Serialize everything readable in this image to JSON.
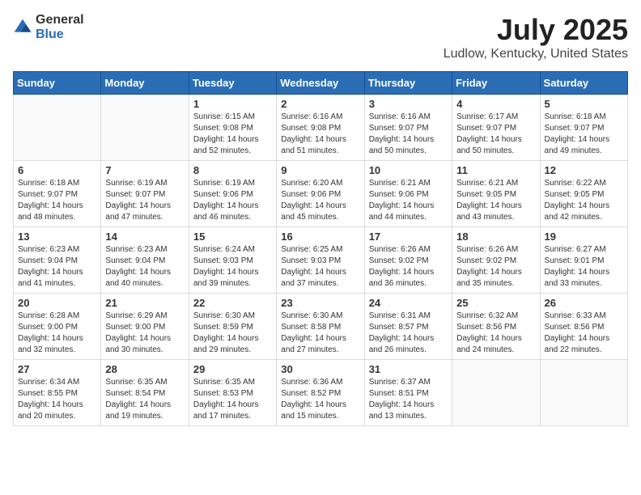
{
  "logo": {
    "text_general": "General",
    "text_blue": "Blue"
  },
  "header": {
    "month": "July 2025",
    "location": "Ludlow, Kentucky, United States"
  },
  "days_of_week": [
    "Sunday",
    "Monday",
    "Tuesday",
    "Wednesday",
    "Thursday",
    "Friday",
    "Saturday"
  ],
  "weeks": [
    [
      {
        "day": "",
        "info": ""
      },
      {
        "day": "",
        "info": ""
      },
      {
        "day": "1",
        "info": "Sunrise: 6:15 AM\nSunset: 9:08 PM\nDaylight: 14 hours and 52 minutes."
      },
      {
        "day": "2",
        "info": "Sunrise: 6:16 AM\nSunset: 9:08 PM\nDaylight: 14 hours and 51 minutes."
      },
      {
        "day": "3",
        "info": "Sunrise: 6:16 AM\nSunset: 9:07 PM\nDaylight: 14 hours and 50 minutes."
      },
      {
        "day": "4",
        "info": "Sunrise: 6:17 AM\nSunset: 9:07 PM\nDaylight: 14 hours and 50 minutes."
      },
      {
        "day": "5",
        "info": "Sunrise: 6:18 AM\nSunset: 9:07 PM\nDaylight: 14 hours and 49 minutes."
      }
    ],
    [
      {
        "day": "6",
        "info": "Sunrise: 6:18 AM\nSunset: 9:07 PM\nDaylight: 14 hours and 48 minutes."
      },
      {
        "day": "7",
        "info": "Sunrise: 6:19 AM\nSunset: 9:07 PM\nDaylight: 14 hours and 47 minutes."
      },
      {
        "day": "8",
        "info": "Sunrise: 6:19 AM\nSunset: 9:06 PM\nDaylight: 14 hours and 46 minutes."
      },
      {
        "day": "9",
        "info": "Sunrise: 6:20 AM\nSunset: 9:06 PM\nDaylight: 14 hours and 45 minutes."
      },
      {
        "day": "10",
        "info": "Sunrise: 6:21 AM\nSunset: 9:06 PM\nDaylight: 14 hours and 44 minutes."
      },
      {
        "day": "11",
        "info": "Sunrise: 6:21 AM\nSunset: 9:05 PM\nDaylight: 14 hours and 43 minutes."
      },
      {
        "day": "12",
        "info": "Sunrise: 6:22 AM\nSunset: 9:05 PM\nDaylight: 14 hours and 42 minutes."
      }
    ],
    [
      {
        "day": "13",
        "info": "Sunrise: 6:23 AM\nSunset: 9:04 PM\nDaylight: 14 hours and 41 minutes."
      },
      {
        "day": "14",
        "info": "Sunrise: 6:23 AM\nSunset: 9:04 PM\nDaylight: 14 hours and 40 minutes."
      },
      {
        "day": "15",
        "info": "Sunrise: 6:24 AM\nSunset: 9:03 PM\nDaylight: 14 hours and 39 minutes."
      },
      {
        "day": "16",
        "info": "Sunrise: 6:25 AM\nSunset: 9:03 PM\nDaylight: 14 hours and 37 minutes."
      },
      {
        "day": "17",
        "info": "Sunrise: 6:26 AM\nSunset: 9:02 PM\nDaylight: 14 hours and 36 minutes."
      },
      {
        "day": "18",
        "info": "Sunrise: 6:26 AM\nSunset: 9:02 PM\nDaylight: 14 hours and 35 minutes."
      },
      {
        "day": "19",
        "info": "Sunrise: 6:27 AM\nSunset: 9:01 PM\nDaylight: 14 hours and 33 minutes."
      }
    ],
    [
      {
        "day": "20",
        "info": "Sunrise: 6:28 AM\nSunset: 9:00 PM\nDaylight: 14 hours and 32 minutes."
      },
      {
        "day": "21",
        "info": "Sunrise: 6:29 AM\nSunset: 9:00 PM\nDaylight: 14 hours and 30 minutes."
      },
      {
        "day": "22",
        "info": "Sunrise: 6:30 AM\nSunset: 8:59 PM\nDaylight: 14 hours and 29 minutes."
      },
      {
        "day": "23",
        "info": "Sunrise: 6:30 AM\nSunset: 8:58 PM\nDaylight: 14 hours and 27 minutes."
      },
      {
        "day": "24",
        "info": "Sunrise: 6:31 AM\nSunset: 8:57 PM\nDaylight: 14 hours and 26 minutes."
      },
      {
        "day": "25",
        "info": "Sunrise: 6:32 AM\nSunset: 8:56 PM\nDaylight: 14 hours and 24 minutes."
      },
      {
        "day": "26",
        "info": "Sunrise: 6:33 AM\nSunset: 8:56 PM\nDaylight: 14 hours and 22 minutes."
      }
    ],
    [
      {
        "day": "27",
        "info": "Sunrise: 6:34 AM\nSunset: 8:55 PM\nDaylight: 14 hours and 20 minutes."
      },
      {
        "day": "28",
        "info": "Sunrise: 6:35 AM\nSunset: 8:54 PM\nDaylight: 14 hours and 19 minutes."
      },
      {
        "day": "29",
        "info": "Sunrise: 6:35 AM\nSunset: 8:53 PM\nDaylight: 14 hours and 17 minutes."
      },
      {
        "day": "30",
        "info": "Sunrise: 6:36 AM\nSunset: 8:52 PM\nDaylight: 14 hours and 15 minutes."
      },
      {
        "day": "31",
        "info": "Sunrise: 6:37 AM\nSunset: 8:51 PM\nDaylight: 14 hours and 13 minutes."
      },
      {
        "day": "",
        "info": ""
      },
      {
        "day": "",
        "info": ""
      }
    ]
  ]
}
